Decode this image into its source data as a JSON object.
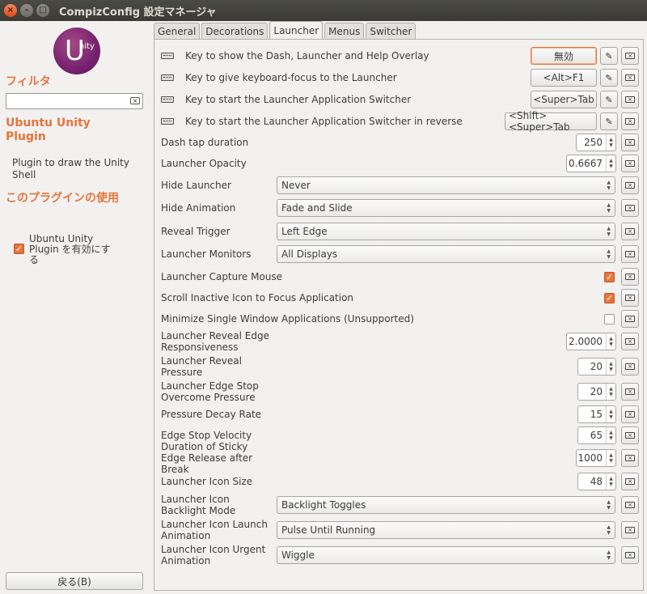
{
  "window": {
    "title": "CompizConfig 設定マネージャ",
    "close_glyph": "×",
    "minimize_glyph": "–",
    "maximize_glyph": "□"
  },
  "sidebar": {
    "logo_letter": "U",
    "logo_text": "nity",
    "filter_heading": "フィルタ",
    "filter_value": "",
    "plugin_title": "Ubuntu Unity Plugin",
    "plugin_description": "Plugin to draw the Unity Shell",
    "usage_heading": "このプラグインの使用",
    "enable_label": "Ubuntu Unity Plugin を有効にする",
    "enable_checked": true,
    "back_button": "戻る(B)"
  },
  "tabs": [
    {
      "label": "General",
      "active": false
    },
    {
      "label": "Decorations",
      "active": false
    },
    {
      "label": "Launcher",
      "active": true
    },
    {
      "label": "Menus",
      "active": false
    },
    {
      "label": "Switcher",
      "active": false
    }
  ],
  "key_settings": [
    {
      "label": "Key to show the Dash, Launcher and Help Overlay",
      "value": "無効"
    },
    {
      "label": "Key to give keyboard-focus to the Launcher",
      "value": "<Alt>F1"
    },
    {
      "label": "Key to start the Launcher Application Switcher",
      "value": "<Super>Tab"
    },
    {
      "label": "Key to start the Launcher Application Switcher in reverse",
      "value": "<Shift><Super>Tab"
    }
  ],
  "settings": {
    "dash_tap_duration": {
      "label": "Dash tap duration",
      "value": "250"
    },
    "launcher_opacity": {
      "label": "Launcher Opacity",
      "value": "0.6667"
    },
    "hide_launcher": {
      "label": "Hide Launcher",
      "value": "Never"
    },
    "hide_animation": {
      "label": "Hide Animation",
      "value": "Fade and Slide"
    },
    "reveal_trigger": {
      "label": "Reveal Trigger",
      "value": "Left Edge"
    },
    "launcher_monitors": {
      "label": "Launcher Monitors",
      "value": "All Displays"
    },
    "capture_mouse": {
      "label": "Launcher Capture Mouse",
      "checked": true
    },
    "scroll_inactive": {
      "label": "Scroll Inactive Icon to Focus Application",
      "checked": true
    },
    "minimize_single": {
      "label": "Minimize Single Window Applications (Unsupported)",
      "checked": false
    },
    "reveal_edge_resp": {
      "label": "Launcher Reveal Edge Responsiveness",
      "value": "2.0000"
    },
    "reveal_pressure": {
      "label": "Launcher Reveal Pressure",
      "value": "20"
    },
    "edge_stop_pressure": {
      "label": "Launcher Edge Stop Overcome Pressure",
      "value": "20"
    },
    "pressure_decay": {
      "label": "Pressure Decay Rate",
      "value": "15"
    },
    "edge_stop_velocity": {
      "label": "Edge Stop Velocity",
      "value": "65"
    },
    "sticky_edge": {
      "label": "Duration of Sticky Edge Release after Break",
      "value": "1000"
    },
    "icon_size": {
      "label": "Launcher Icon Size",
      "value": "48"
    },
    "backlight_mode": {
      "label": "Launcher Icon Backlight Mode",
      "value": "Backlight Toggles"
    },
    "launch_animation": {
      "label": "Launcher Icon Launch Animation",
      "value": "Pulse Until Running"
    },
    "urgent_animation": {
      "label": "Launcher Icon Urgent Animation",
      "value": "Wiggle"
    }
  },
  "glyphs": {
    "pencil": "✎",
    "check": "✓",
    "reset": "×",
    "spin_up": "▲",
    "spin_down": "▼"
  },
  "colors": {
    "accent": "#e8743b",
    "titlebar": "#3c3b37",
    "logo": "#77216f"
  }
}
